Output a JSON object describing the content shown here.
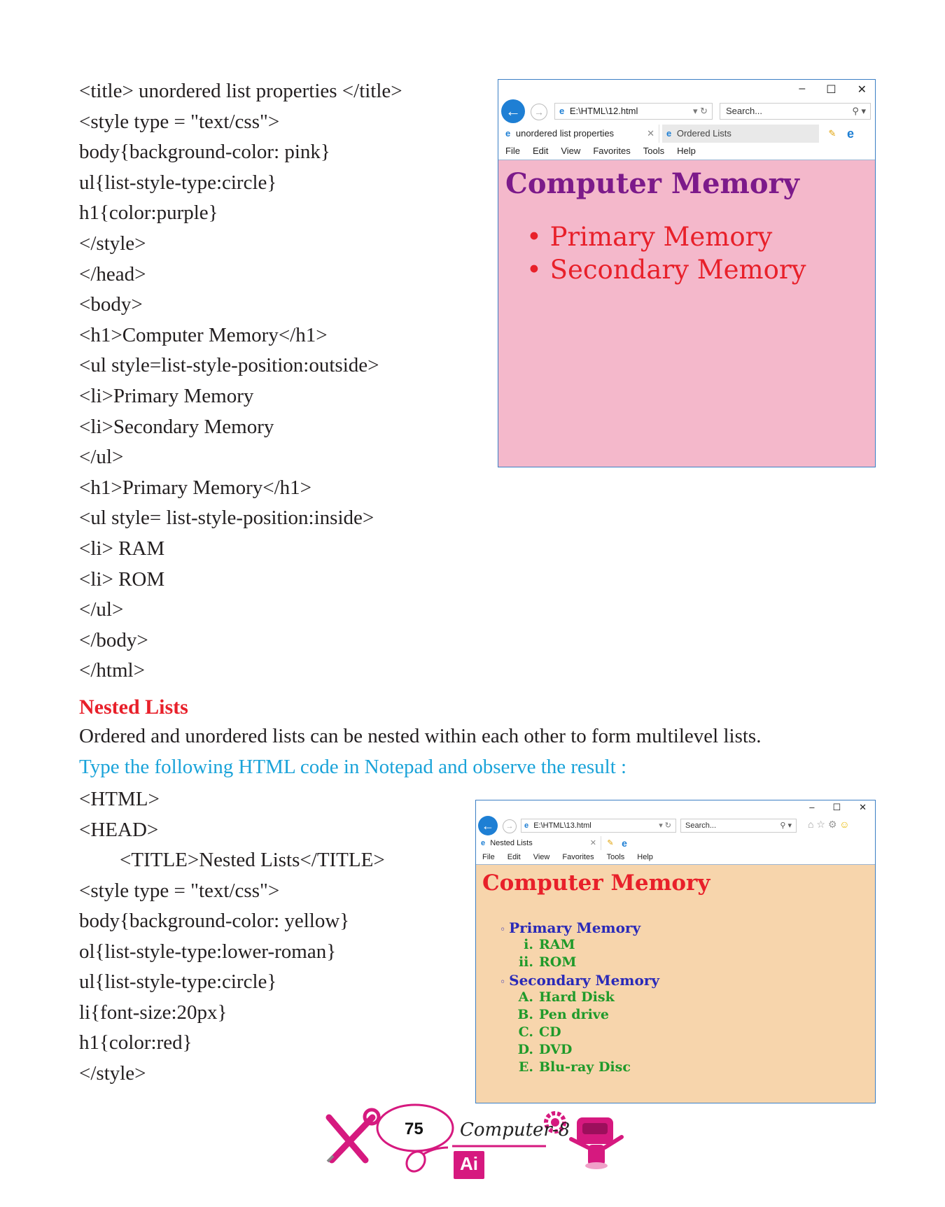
{
  "code_block_1": [
    "<title> unordered list properties </title>",
    "<style type = \"text/css\">",
    "body{background-color: pink}",
    "ul{list-style-type:circle}",
    "h1{color:purple}",
    "</style>",
    "</head>",
    "<body>",
    "<h1>Computer Memory</h1>",
    "<ul style=list-style-position:outside>",
    "<li>Primary Memory",
    "<li>Secondary Memory",
    "</ul>",
    "<h1>Primary Memory</h1>",
    "<ul style= list-style-position:inside>",
    "<li> RAM",
    "<li> ROM",
    "</ul>",
    "</body>",
    "</html>"
  ],
  "section": {
    "heading": "Nested Lists",
    "paragraph": "Ordered and unordered lists can be nested within each other to form multilevel lists.",
    "instruction": "Type the following HTML code in Notepad and observe the result :"
  },
  "code_block_2": [
    "<HTML>",
    "<HEAD>",
    "        <TITLE>Nested Lists</TITLE>",
    "<style type = \"text/css\">",
    "body{background-color: yellow}",
    "ol{list-style-type:lower-roman}",
    "ul{list-style-type:circle}",
    "li{font-size:20px}",
    "h1{color:red}",
    "</style>"
  ],
  "browser1": {
    "address": "E:\\HTML\\12.html",
    "search_placeholder": "Search...",
    "tab_active": "unordered list properties",
    "tab_inactive": "Ordered Lists",
    "menu": [
      "File",
      "Edit",
      "View",
      "Favorites",
      "Tools",
      "Help"
    ],
    "bg_color": "#f4b8cb",
    "h1": "Computer Memory",
    "h1_color": "#7c1a8a",
    "items": [
      "Primary Memory",
      "Secondary Memory"
    ],
    "item_color": "#e8202a"
  },
  "browser2": {
    "address": "E:\\HTML\\13.html",
    "search_placeholder": "Search...",
    "tab_active": "Nested Lists",
    "menu": [
      "File",
      "Edit",
      "View",
      "Favorites",
      "Tools",
      "Help"
    ],
    "bg_color": "#f7d5ac",
    "h1": "Computer Memory",
    "h1_color": "#e8202a",
    "item_color": "#2a2ab8",
    "sub_color": "#1f9a2a",
    "items": [
      {
        "label": "Primary Memory",
        "subs": [
          {
            "marker": "i.",
            "text": "RAM"
          },
          {
            "marker": "ii.",
            "text": "ROM"
          }
        ]
      },
      {
        "label": "Secondary Memory",
        "subs": [
          {
            "marker": "A.",
            "text": "Hard Disk"
          },
          {
            "marker": "B.",
            "text": "Pen drive"
          },
          {
            "marker": "C.",
            "text": "CD"
          },
          {
            "marker": "D.",
            "text": "DVD"
          },
          {
            "marker": "E.",
            "text": "Blu-ray Disc"
          }
        ]
      }
    ]
  },
  "footer": {
    "page_number": "75",
    "brand": "Computer-8",
    "ai_badge": "Ai"
  },
  "colors": {
    "heading_red": "#e8202a",
    "instruction_blue": "#1aa3d9",
    "footer_magenta": "#d6197f"
  }
}
